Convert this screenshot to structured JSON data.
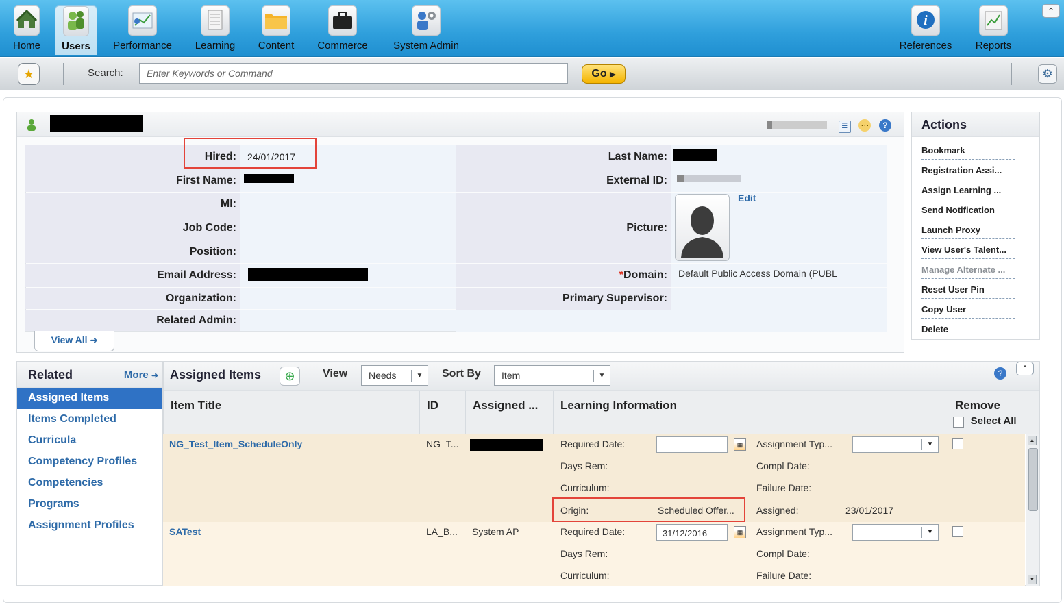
{
  "nav": {
    "items": [
      {
        "label": "Home",
        "icon": "home-icon"
      },
      {
        "label": "Users",
        "icon": "users-icon"
      },
      {
        "label": "Performance",
        "icon": "performance-icon"
      },
      {
        "label": "Learning",
        "icon": "learning-icon"
      },
      {
        "label": "Content",
        "icon": "folder-icon"
      },
      {
        "label": "Commerce",
        "icon": "briefcase-icon"
      },
      {
        "label": "System Admin",
        "icon": "system-admin-icon"
      }
    ],
    "right_items": [
      {
        "label": "References",
        "icon": "info-icon"
      },
      {
        "label": "Reports",
        "icon": "reports-icon"
      }
    ],
    "active": "Users"
  },
  "search": {
    "label": "Search:",
    "placeholder": "Enter Keywords or Command",
    "go_label": "Go"
  },
  "profile": {
    "fields_left": [
      {
        "label": "Hired:",
        "value": "24/01/2017"
      },
      {
        "label": "First Name:",
        "value": ""
      },
      {
        "label": "MI:",
        "value": ""
      },
      {
        "label": "Job Code:",
        "value": ""
      },
      {
        "label": "Position:",
        "value": ""
      },
      {
        "label": "Email Address:",
        "value": ""
      },
      {
        "label": "Organization:",
        "value": ""
      },
      {
        "label": "Related Admin:",
        "value": ""
      }
    ],
    "fields_right": {
      "last_name_label": "Last Name:",
      "external_id_label": "External ID:",
      "picture_label": "Picture:",
      "edit_label": "Edit",
      "domain_required": "*",
      "domain_label": "Domain:",
      "domain_value": "Default Public Access Domain (PUBL",
      "supervisor_label": "Primary Supervisor:"
    },
    "view_all_label": "View All"
  },
  "actions": {
    "title": "Actions",
    "items": [
      {
        "label": "Bookmark",
        "disabled": false
      },
      {
        "label": "Registration Assi...",
        "disabled": false
      },
      {
        "label": "Assign Learning ...",
        "disabled": false
      },
      {
        "label": "Send Notification",
        "disabled": false
      },
      {
        "label": "Launch Proxy",
        "disabled": false
      },
      {
        "label": "View User's Talent...",
        "disabled": false
      },
      {
        "label": "Manage Alternate ...",
        "disabled": true
      },
      {
        "label": "Reset User Pin",
        "disabled": false
      },
      {
        "label": "Copy User",
        "disabled": false
      },
      {
        "label": "Delete",
        "disabled": false
      }
    ]
  },
  "related": {
    "title": "Related",
    "more_label": "More",
    "items": [
      "Assigned Items",
      "Items Completed",
      "Curricula",
      "Competency Profiles",
      "Competencies",
      "Programs",
      "Assignment Profiles"
    ],
    "active": "Assigned Items"
  },
  "assigned": {
    "title": "Assigned Items",
    "view_label": "View",
    "view_value": "Needs",
    "sort_label": "Sort By",
    "sort_value": "Item",
    "columns": [
      "Item Title",
      "ID",
      "Assigned ...",
      "Learning Information",
      "Remove"
    ],
    "select_all_label": "Select All",
    "li_labels": {
      "required_date": "Required Date:",
      "days_rem": "Days Rem:",
      "curriculum": "Curriculum:",
      "origin": "Origin:",
      "assignment_type": "Assignment Typ...",
      "compl_date": "Compl Date:",
      "failure_date": "Failure Date:",
      "assigned": "Assigned:"
    },
    "rows": [
      {
        "title": "NG_Test_Item_ScheduleOnly",
        "id": "NG_T...",
        "assigned_by": "",
        "required_date": "",
        "origin": "Scheduled Offer...",
        "assigned_date": "23/01/2017"
      },
      {
        "title": "SATest",
        "id": "LA_B...",
        "assigned_by": "System AP",
        "required_date": "31/12/2016",
        "origin": "",
        "assigned_date": ""
      }
    ]
  }
}
